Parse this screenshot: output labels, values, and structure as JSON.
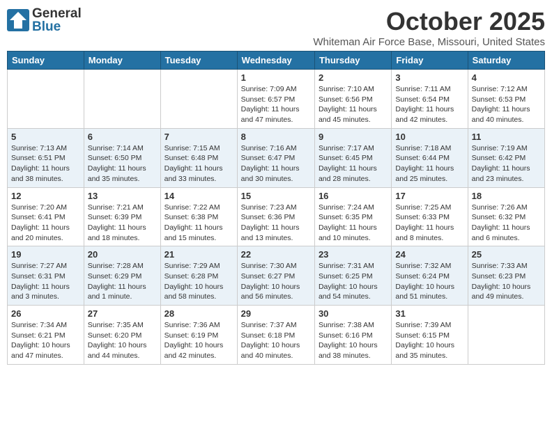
{
  "header": {
    "logo_general": "General",
    "logo_blue": "Blue",
    "month": "October 2025",
    "location": "Whiteman Air Force Base, Missouri, United States"
  },
  "weekdays": [
    "Sunday",
    "Monday",
    "Tuesday",
    "Wednesday",
    "Thursday",
    "Friday",
    "Saturday"
  ],
  "weeks": [
    [
      {
        "day": "",
        "info": ""
      },
      {
        "day": "",
        "info": ""
      },
      {
        "day": "",
        "info": ""
      },
      {
        "day": "1",
        "info": "Sunrise: 7:09 AM\nSunset: 6:57 PM\nDaylight: 11 hours\nand 47 minutes."
      },
      {
        "day": "2",
        "info": "Sunrise: 7:10 AM\nSunset: 6:56 PM\nDaylight: 11 hours\nand 45 minutes."
      },
      {
        "day": "3",
        "info": "Sunrise: 7:11 AM\nSunset: 6:54 PM\nDaylight: 11 hours\nand 42 minutes."
      },
      {
        "day": "4",
        "info": "Sunrise: 7:12 AM\nSunset: 6:53 PM\nDaylight: 11 hours\nand 40 minutes."
      }
    ],
    [
      {
        "day": "5",
        "info": "Sunrise: 7:13 AM\nSunset: 6:51 PM\nDaylight: 11 hours\nand 38 minutes."
      },
      {
        "day": "6",
        "info": "Sunrise: 7:14 AM\nSunset: 6:50 PM\nDaylight: 11 hours\nand 35 minutes."
      },
      {
        "day": "7",
        "info": "Sunrise: 7:15 AM\nSunset: 6:48 PM\nDaylight: 11 hours\nand 33 minutes."
      },
      {
        "day": "8",
        "info": "Sunrise: 7:16 AM\nSunset: 6:47 PM\nDaylight: 11 hours\nand 30 minutes."
      },
      {
        "day": "9",
        "info": "Sunrise: 7:17 AM\nSunset: 6:45 PM\nDaylight: 11 hours\nand 28 minutes."
      },
      {
        "day": "10",
        "info": "Sunrise: 7:18 AM\nSunset: 6:44 PM\nDaylight: 11 hours\nand 25 minutes."
      },
      {
        "day": "11",
        "info": "Sunrise: 7:19 AM\nSunset: 6:42 PM\nDaylight: 11 hours\nand 23 minutes."
      }
    ],
    [
      {
        "day": "12",
        "info": "Sunrise: 7:20 AM\nSunset: 6:41 PM\nDaylight: 11 hours\nand 20 minutes."
      },
      {
        "day": "13",
        "info": "Sunrise: 7:21 AM\nSunset: 6:39 PM\nDaylight: 11 hours\nand 18 minutes."
      },
      {
        "day": "14",
        "info": "Sunrise: 7:22 AM\nSunset: 6:38 PM\nDaylight: 11 hours\nand 15 minutes."
      },
      {
        "day": "15",
        "info": "Sunrise: 7:23 AM\nSunset: 6:36 PM\nDaylight: 11 hours\nand 13 minutes."
      },
      {
        "day": "16",
        "info": "Sunrise: 7:24 AM\nSunset: 6:35 PM\nDaylight: 11 hours\nand 10 minutes."
      },
      {
        "day": "17",
        "info": "Sunrise: 7:25 AM\nSunset: 6:33 PM\nDaylight: 11 hours\nand 8 minutes."
      },
      {
        "day": "18",
        "info": "Sunrise: 7:26 AM\nSunset: 6:32 PM\nDaylight: 11 hours\nand 6 minutes."
      }
    ],
    [
      {
        "day": "19",
        "info": "Sunrise: 7:27 AM\nSunset: 6:31 PM\nDaylight: 11 hours\nand 3 minutes."
      },
      {
        "day": "20",
        "info": "Sunrise: 7:28 AM\nSunset: 6:29 PM\nDaylight: 11 hours\nand 1 minute."
      },
      {
        "day": "21",
        "info": "Sunrise: 7:29 AM\nSunset: 6:28 PM\nDaylight: 10 hours\nand 58 minutes."
      },
      {
        "day": "22",
        "info": "Sunrise: 7:30 AM\nSunset: 6:27 PM\nDaylight: 10 hours\nand 56 minutes."
      },
      {
        "day": "23",
        "info": "Sunrise: 7:31 AM\nSunset: 6:25 PM\nDaylight: 10 hours\nand 54 minutes."
      },
      {
        "day": "24",
        "info": "Sunrise: 7:32 AM\nSunset: 6:24 PM\nDaylight: 10 hours\nand 51 minutes."
      },
      {
        "day": "25",
        "info": "Sunrise: 7:33 AM\nSunset: 6:23 PM\nDaylight: 10 hours\nand 49 minutes."
      }
    ],
    [
      {
        "day": "26",
        "info": "Sunrise: 7:34 AM\nSunset: 6:21 PM\nDaylight: 10 hours\nand 47 minutes."
      },
      {
        "day": "27",
        "info": "Sunrise: 7:35 AM\nSunset: 6:20 PM\nDaylight: 10 hours\nand 44 minutes."
      },
      {
        "day": "28",
        "info": "Sunrise: 7:36 AM\nSunset: 6:19 PM\nDaylight: 10 hours\nand 42 minutes."
      },
      {
        "day": "29",
        "info": "Sunrise: 7:37 AM\nSunset: 6:18 PM\nDaylight: 10 hours\nand 40 minutes."
      },
      {
        "day": "30",
        "info": "Sunrise: 7:38 AM\nSunset: 6:16 PM\nDaylight: 10 hours\nand 38 minutes."
      },
      {
        "day": "31",
        "info": "Sunrise: 7:39 AM\nSunset: 6:15 PM\nDaylight: 10 hours\nand 35 minutes."
      },
      {
        "day": "",
        "info": ""
      }
    ]
  ]
}
